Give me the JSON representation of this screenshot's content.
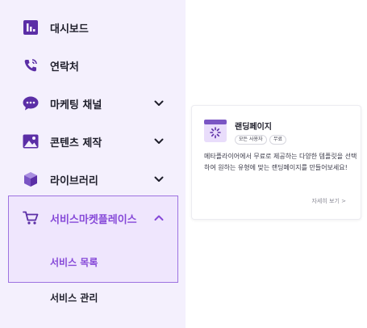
{
  "sidebar": {
    "items": [
      {
        "label": "대시보드",
        "icon": "chart-bar-icon"
      },
      {
        "label": "연락처",
        "icon": "phone-icon"
      },
      {
        "label": "마케팅 채널",
        "icon": "chat-bubble-icon"
      },
      {
        "label": "콘텐츠 제작",
        "icon": "image-icon"
      },
      {
        "label": "라이브러리",
        "icon": "cube-icon"
      },
      {
        "label": "서비스마켓플레이스",
        "icon": "cart-icon"
      }
    ],
    "subitems": [
      {
        "label": "서비스 목록",
        "active": true
      },
      {
        "label": "서비스 관리",
        "active": false
      }
    ]
  },
  "card": {
    "title": "랜딩페이지",
    "badges": [
      "모든 사용자",
      "무료"
    ],
    "description": "메타플라이어에서 무료로 제공하는 다양한 템플릿을 선택하여 원하는 유형에 맞는 랜딩페이지를 만들어보세요!",
    "link": "자세히 보기 >"
  },
  "colors": {
    "sidebar_bg": "#f4f0fd",
    "accent": "#8649d8",
    "icon_purple": "#5b2ea6"
  }
}
